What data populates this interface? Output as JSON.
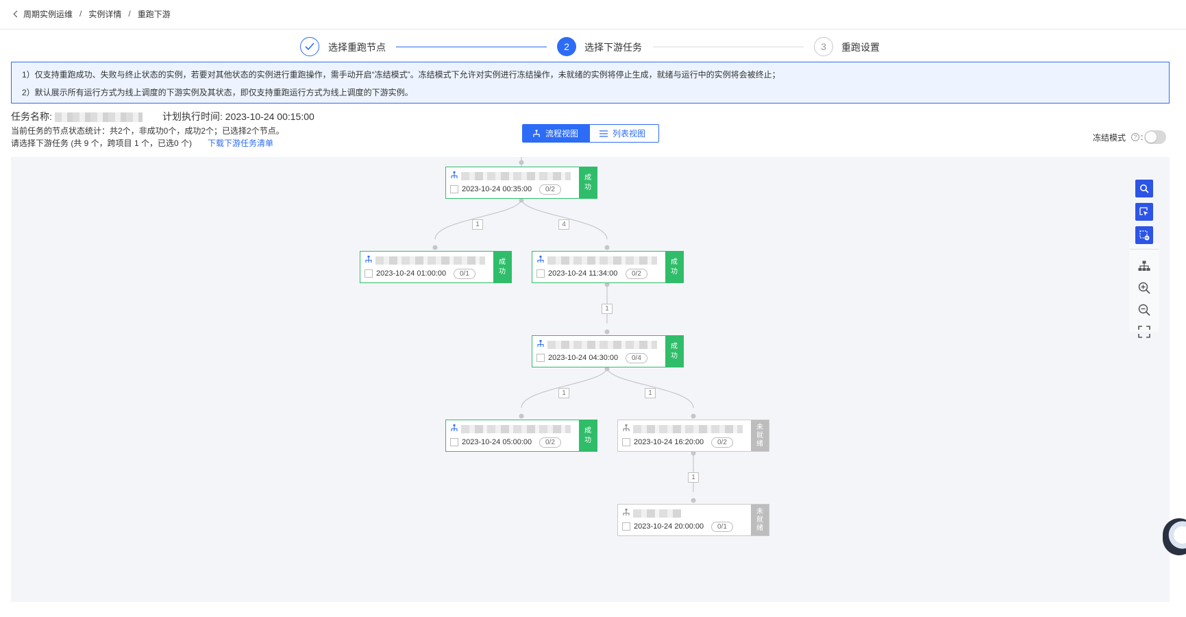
{
  "breadcrumb": {
    "items": [
      "周期实例运维",
      "实例详情",
      "重跑下游"
    ],
    "separator": "/"
  },
  "steps": [
    {
      "number": "1",
      "label": "选择重跑节点",
      "state": "done"
    },
    {
      "number": "2",
      "label": "选择下游任务",
      "state": "active"
    },
    {
      "number": "3",
      "label": "重跑设置",
      "state": "pending"
    }
  ],
  "notice": {
    "line1": "1）仅支持重跑成功、失败与终止状态的实例，若要对其他状态的实例进行重跑操作，需手动开启“冻结模式”。冻结模式下允许对实例进行冻结操作，未就绪的实例将停止生成，就绪与运行中的实例将会被终止；",
    "line2": "2）默认展示所有运行方式为线上调度的下游实例及其状态，即仅支持重跑运行方式为线上调度的下游实例。"
  },
  "task": {
    "name_label": "任务名称:",
    "time_label": "计划执行时间:",
    "time_value": "2023-10-24 00:15:00",
    "stats": "当前任务的节点状态统计：共2个，非成功0个，成功2个；已选择2个节点。",
    "select_hint": "请选择下游任务 (共 9 个，跨项目 1 个，已选0 个)",
    "download_link": "下载下游任务清单"
  },
  "views": {
    "flow": "流程视图",
    "list": "列表视图"
  },
  "freeze": {
    "label": "冻结模式",
    "help": "?",
    "enabled": false
  },
  "colors": {
    "primary": "#2c6cf6",
    "success": "#2fbd6a",
    "pending": "#bdbdbd",
    "canvas": "#f4f5f8"
  },
  "graph": {
    "nodes": [
      {
        "id": "n1",
        "time": "2023-10-24 00:35:00",
        "count": "0/2",
        "status": "成功",
        "kind": "success"
      },
      {
        "id": "n2",
        "time": "2023-10-24 01:00:00",
        "count": "0/1",
        "status": "成功",
        "kind": "success"
      },
      {
        "id": "n3",
        "time": "2023-10-24 11:34:00",
        "count": "0/2",
        "status": "成功",
        "kind": "success"
      },
      {
        "id": "n4",
        "time": "2023-10-24 04:30:00",
        "count": "0/4",
        "status": "成功",
        "kind": "success"
      },
      {
        "id": "n5",
        "time": "2023-10-24 05:00:00",
        "count": "0/2",
        "status": "成功",
        "kind": "success"
      },
      {
        "id": "n6",
        "time": "2023-10-24 16:20:00",
        "count": "0/2",
        "status": "未就绪",
        "kind": "pending"
      },
      {
        "id": "n7",
        "time": "2023-10-24 20:00:00",
        "count": "0/1",
        "status": "未就绪",
        "kind": "pending"
      }
    ],
    "edges": [
      {
        "from": "n1",
        "to": "n2",
        "label": "1"
      },
      {
        "from": "n1",
        "to": "n3",
        "label": "4"
      },
      {
        "from": "n3",
        "to": "n4",
        "label": "1"
      },
      {
        "from": "n4",
        "to": "n5",
        "label": "1"
      },
      {
        "from": "n4",
        "to": "n6",
        "label": "1"
      },
      {
        "from": "n6",
        "to": "n7",
        "label": "1"
      }
    ]
  },
  "tools": [
    "search-icon",
    "select-cursor-icon",
    "deselect-box-icon",
    "hierarchy-layout-icon",
    "zoom-in-icon",
    "zoom-out-icon",
    "fullscreen-icon"
  ]
}
